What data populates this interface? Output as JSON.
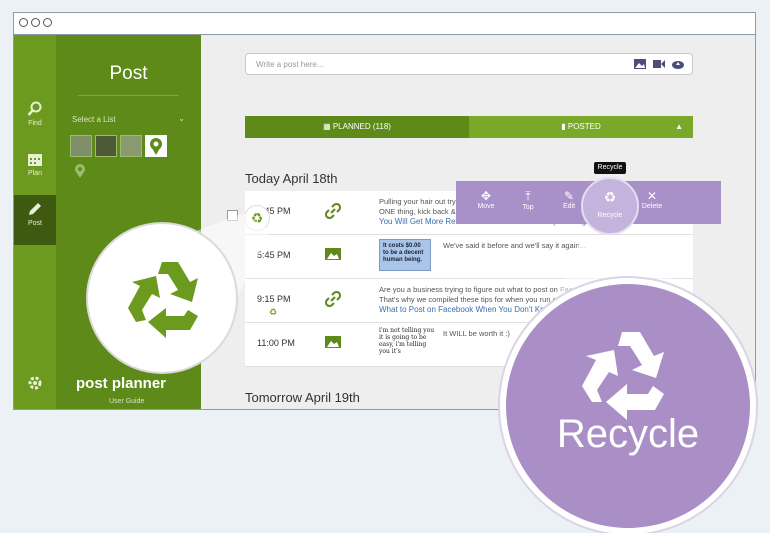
{
  "rail": {
    "items": [
      {
        "label": "Find",
        "icon": "search-icon"
      },
      {
        "label": "Plan",
        "icon": "calendar-icon"
      },
      {
        "label": "Post",
        "icon": "pencil-icon"
      }
    ],
    "settings_icon": "gear-icon"
  },
  "panel": {
    "title": "Post",
    "select_list": "Select a List",
    "logo": "post planner",
    "user_guide": "User Guide"
  },
  "composer": {
    "placeholder": "Write a post here..."
  },
  "tabs": {
    "planned": "PLANNED (118)",
    "posted": "POSTED"
  },
  "days": [
    {
      "label": "Today April 18th"
    },
    {
      "label": "Tomorrow April 19th"
    }
  ],
  "posts": [
    {
      "time": "3:45 PM",
      "type": "link-icon",
      "line1": "Pulling your hair out trying to get the word out about your Twitter? Don't! Just do the",
      "line2": "ONE thing, kick back & watch the numbers climb.",
      "link": "You Will Get More Retweets If You Do This 1 Simple Thing"
    },
    {
      "time": "5:45 PM",
      "type": "image-icon",
      "image_text": "It costs $0.00 to be a decent human being.",
      "line1": "We've said it before and we'll say it again..."
    },
    {
      "time": "9:15 PM",
      "type": "link-icon",
      "line1": "Are you a business trying to figure out what to post on Facebook?",
      "line2": "That's why we compiled these tips for when you run out of ideas.",
      "link": "What to Post on Facebook When You Don't Know What to Post"
    },
    {
      "time": "11:00 PM",
      "type": "image-icon",
      "image_text": "i'm not telling you it is going to be easy, i'm telling you it's",
      "line1": "It WILL be worth it :)"
    }
  ],
  "actions": {
    "items": [
      {
        "label": "Move",
        "icon": "move-icon"
      },
      {
        "label": "Top",
        "icon": "top-icon"
      },
      {
        "label": "Edit",
        "icon": "pencil-icon"
      },
      {
        "label": "Recycle",
        "icon": "recycle-icon"
      },
      {
        "label": "Delete",
        "icon": "close-icon"
      }
    ],
    "tooltip": "Recycle"
  },
  "callouts": {
    "large_label": "Recycle"
  },
  "colors": {
    "green_dark": "#5d8a18",
    "green_rail": "#6b9a1e",
    "green_tab": "#7aa92a",
    "purple": "#a98fc6"
  }
}
